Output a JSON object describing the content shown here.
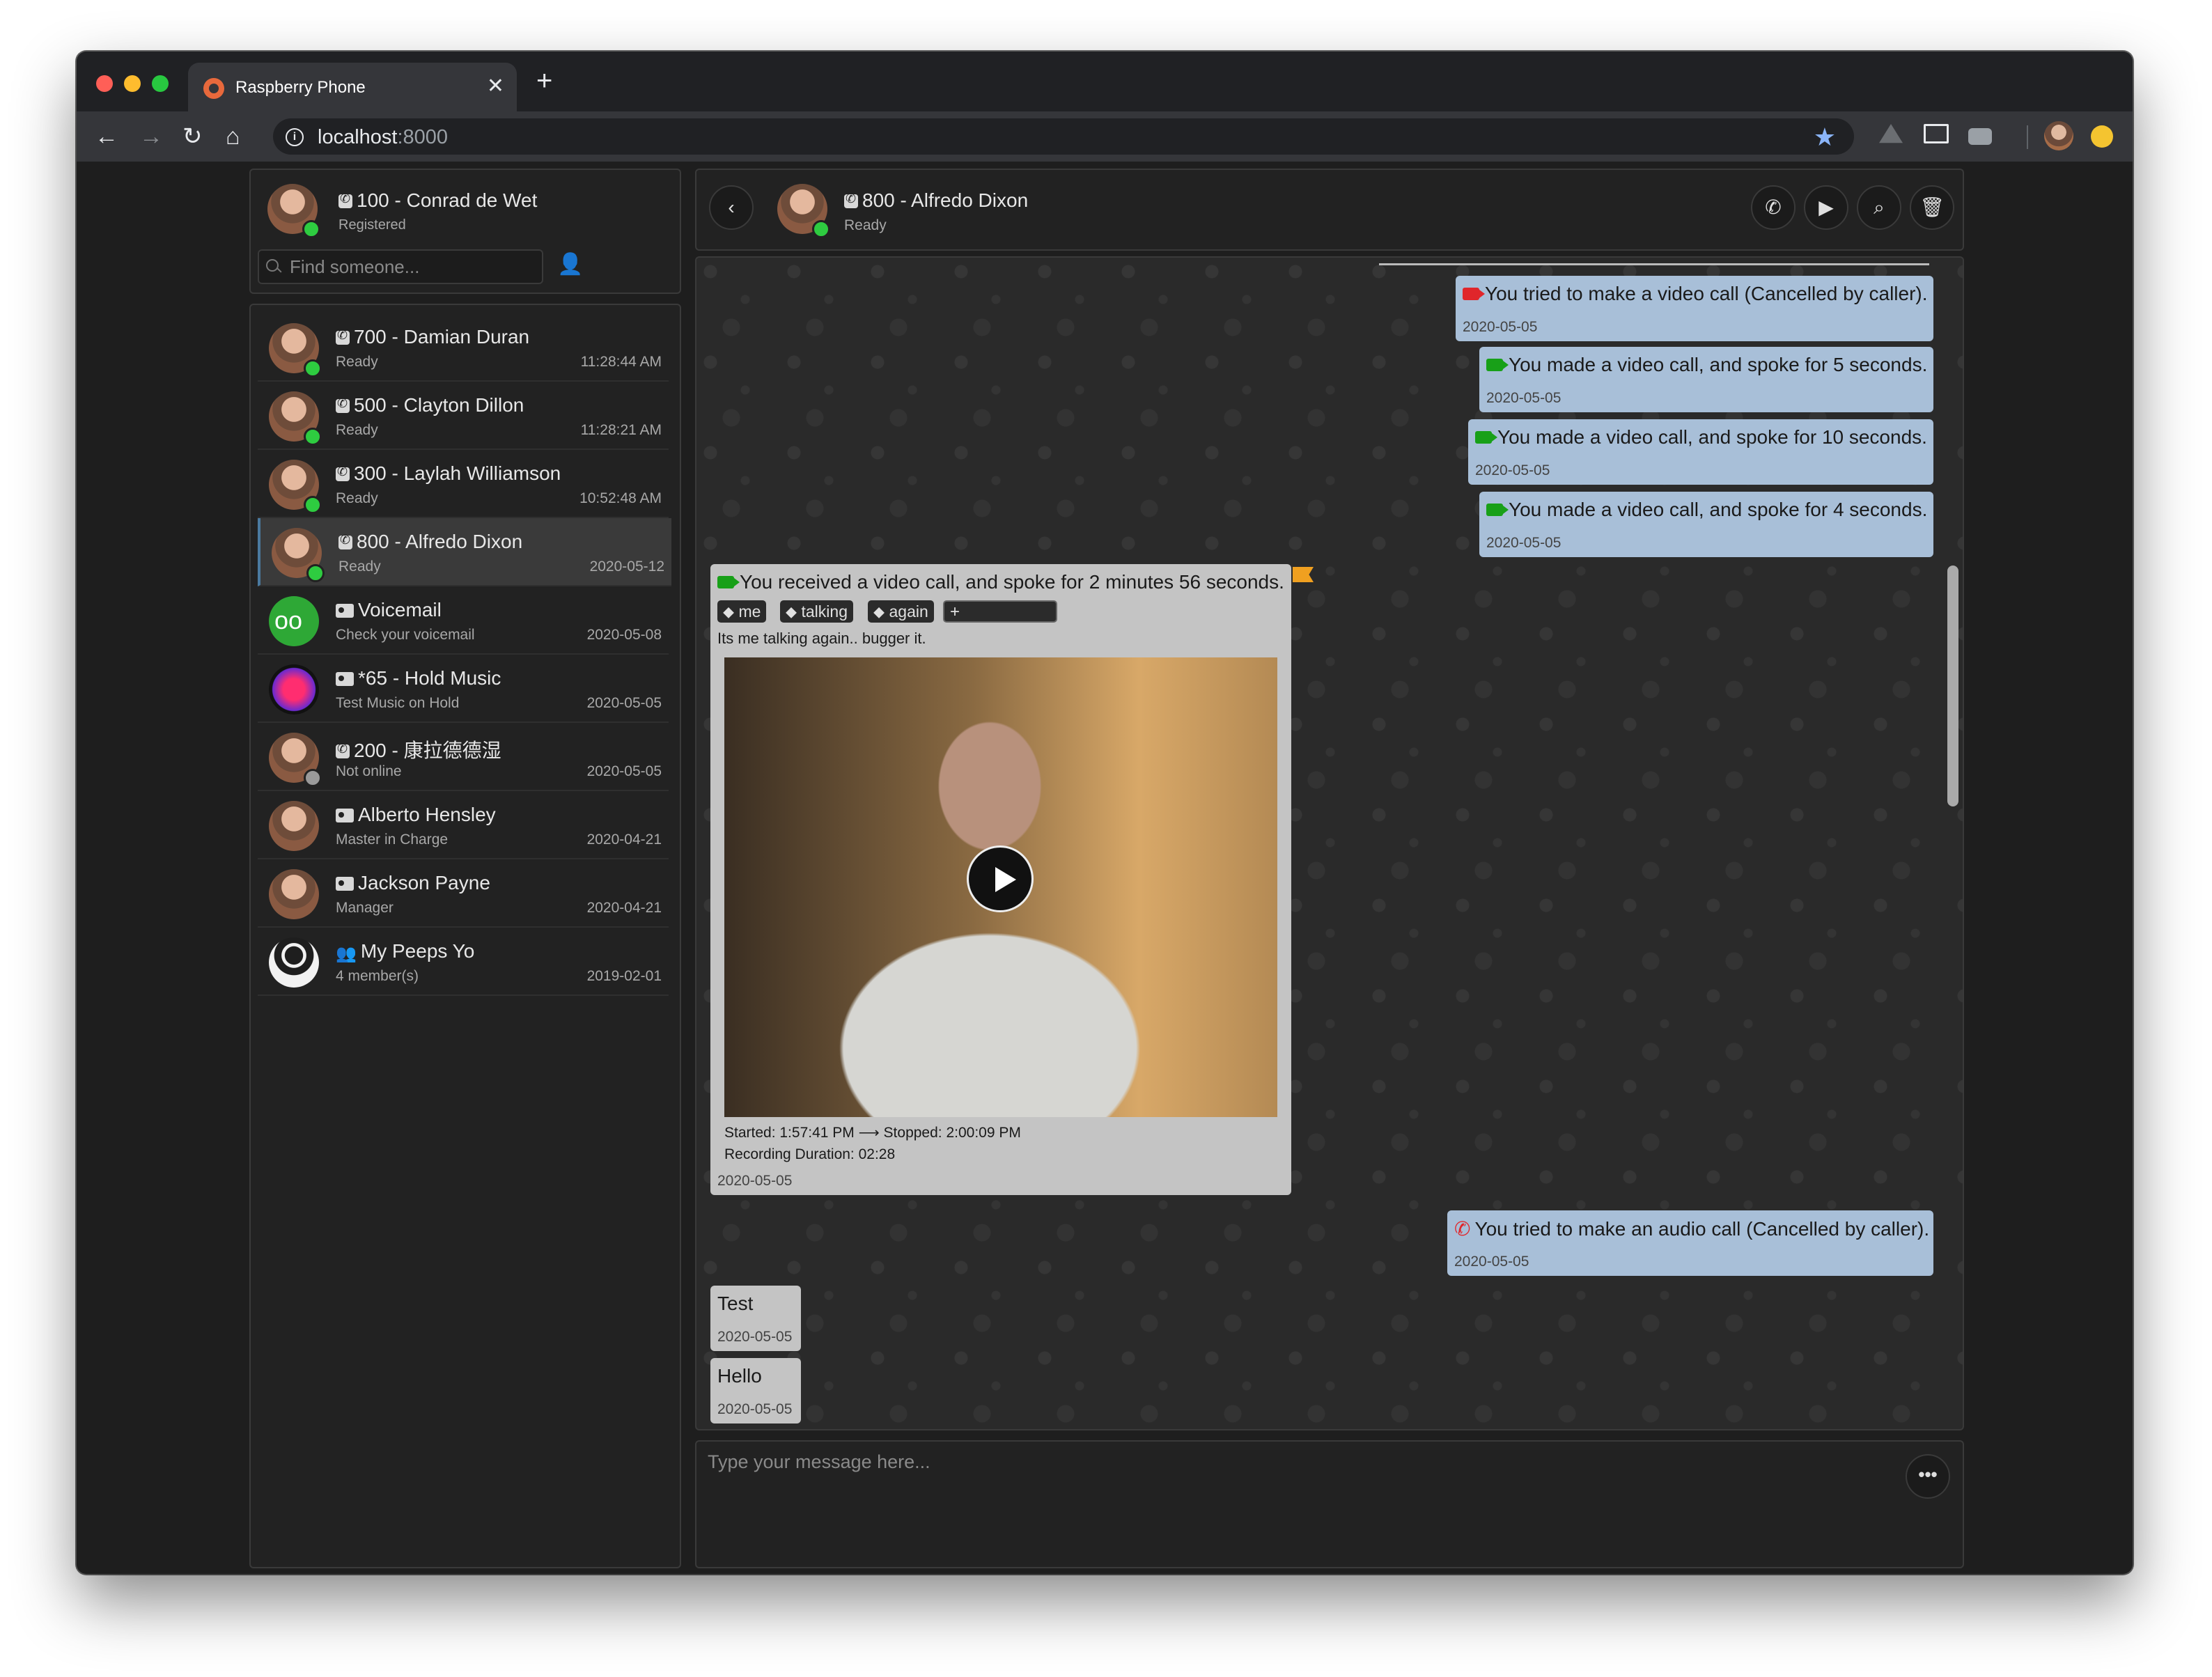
{
  "browser": {
    "tab_title": "Raspberry Phone",
    "tab_close": "✕",
    "new_tab": "+",
    "url_host": "localhost",
    "url_port": ":8000",
    "info_glyph": "i"
  },
  "me": {
    "name": "100 - Conrad de Wet",
    "status": "Registered",
    "search_placeholder": "Find someone..."
  },
  "buddies": [
    {
      "name": "700 - Damian Duran",
      "desc": "Ready",
      "time": "11:28:44 AM",
      "icon": "phone-icon",
      "presence": "online"
    },
    {
      "name": "500 - Clayton Dillon",
      "desc": "Ready",
      "time": "11:28:21 AM",
      "icon": "phone-icon",
      "presence": "online"
    },
    {
      "name": "300 - Laylah Williamson",
      "desc": "Ready",
      "time": "10:52:48 AM",
      "icon": "phone-icon",
      "presence": "online"
    },
    {
      "name": "800 - Alfredo Dixon",
      "desc": "Ready",
      "time": "2020-05-12",
      "icon": "phone-icon",
      "presence": "online",
      "selected": true
    },
    {
      "name": "Voicemail",
      "desc": "Check your voicemail",
      "time": "2020-05-08",
      "icon": "contact-card-icon"
    },
    {
      "name": "*65 - Hold Music",
      "desc": "Test Music on Hold",
      "time": "2020-05-05",
      "icon": "contact-card-icon"
    },
    {
      "name": "200 - 康拉德德湿",
      "desc": "Not online",
      "time": "2020-05-05",
      "icon": "phone-icon",
      "presence": "offline"
    },
    {
      "name": "Alberto Hensley",
      "desc": "Master in Charge",
      "time": "2020-04-21",
      "icon": "contact-card-icon"
    },
    {
      "name": "Jackson Payne",
      "desc": "Manager",
      "time": "2020-04-21",
      "icon": "contact-card-icon"
    },
    {
      "name": "My Peeps Yo",
      "desc": "4 member(s)",
      "time": "2019-02-01",
      "icon": "group-icon"
    }
  ],
  "chat": {
    "contact_name": "800 - Alfredo Dixon",
    "contact_status": "Ready",
    "composer_placeholder": "Type your message here...",
    "more_glyph": "•••",
    "messages": [
      {
        "dir": "out",
        "icon": "video-red",
        "text": "You tried to make a video call (Cancelled by caller).",
        "date": "2020-05-05"
      },
      {
        "dir": "out",
        "icon": "video-green",
        "text": "You made a video call, and spoke for 5 seconds.",
        "date": "2020-05-05"
      },
      {
        "dir": "out",
        "icon": "video-green",
        "text": "You made a video call, and spoke for 10 seconds.",
        "date": "2020-05-05"
      },
      {
        "dir": "out",
        "icon": "video-green",
        "text": "You made a video call, and spoke for 4 seconds.",
        "date": "2020-05-05"
      },
      {
        "dir": "in",
        "icon": "video-green",
        "text": "You received a video call, and spoke for 2 minutes 56 seconds.",
        "date": "2020-05-05",
        "tags": [
          "me",
          "talking",
          "again"
        ],
        "tag_add": "+",
        "note": "Its me talking again.. bugger it.",
        "recording_times": "Started: 1:57:41 PM ⟶ Stopped: 2:00:09 PM",
        "recording_duration": "Recording Duration: 02:28"
      },
      {
        "dir": "out",
        "icon": "phone-red",
        "text": "You tried to make an audio call (Cancelled by caller).",
        "date": "2020-05-05"
      },
      {
        "dir": "in",
        "text": "Test",
        "date": "2020-05-05"
      },
      {
        "dir": "in",
        "text": "Hello",
        "date": "2020-05-05"
      }
    ]
  },
  "colors": {
    "online": "#2ecc40",
    "offline": "#9a9a9a",
    "outgoing_bubble": "#a8bfd8",
    "incoming_bubble": "#c4c4c4",
    "voicemail_green": "#2ea836"
  }
}
